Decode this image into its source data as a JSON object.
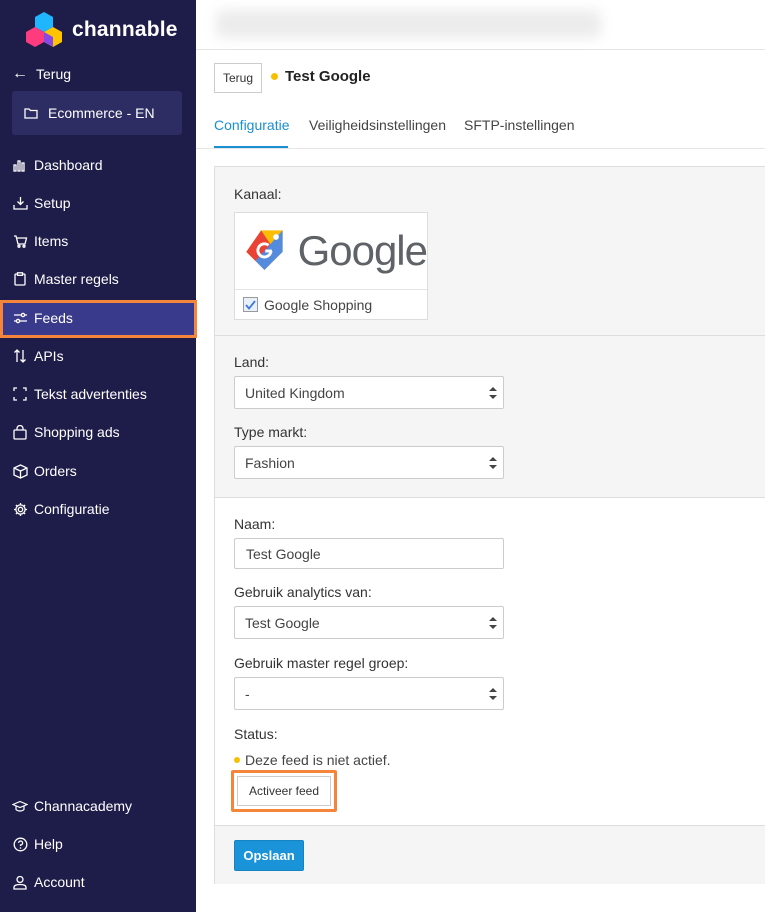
{
  "brand": {
    "name": "channable"
  },
  "sidebar": {
    "back_label": "Terug",
    "project_label": "Ecommerce - EN",
    "items": [
      {
        "label": "Dashboard",
        "icon": "chart-bars-icon"
      },
      {
        "label": "Setup",
        "icon": "download-tray-icon"
      },
      {
        "label": "Items",
        "icon": "cart-icon"
      },
      {
        "label": "Master regels",
        "icon": "clipboard-icon"
      },
      {
        "label": "Feeds",
        "icon": "sliders-icon",
        "active": true
      },
      {
        "label": "APIs",
        "icon": "arrows-up-down-icon"
      },
      {
        "label": "Tekst advertenties",
        "icon": "bracket-frame-icon"
      },
      {
        "label": "Shopping ads",
        "icon": "shopping-bag-icon"
      },
      {
        "label": "Orders",
        "icon": "box-icon"
      },
      {
        "label": "Configuratie",
        "icon": "gear-icon"
      }
    ],
    "bottom_items": [
      {
        "label": "Channacademy",
        "icon": "graduation-cap-icon"
      },
      {
        "label": "Help",
        "icon": "question-circle-icon"
      },
      {
        "label": "Account",
        "icon": "user-icon"
      }
    ],
    "active_color": "#3a3a8c",
    "highlight_color": "#f4853a"
  },
  "header": {
    "back_button": "Terug",
    "feed_title": "Test Google",
    "status_dot_color": "#f5c000"
  },
  "tabs": [
    {
      "label": "Configuratie",
      "active": true
    },
    {
      "label": "Veiligheidsinstellingen"
    },
    {
      "label": "SFTP-instellingen"
    }
  ],
  "form": {
    "channel_label": "Kanaal:",
    "channel_logo_text": "Google",
    "channel_name": "Google Shopping",
    "channel_checked": true,
    "country_label": "Land:",
    "country_value": "United Kingdom",
    "market_label": "Type markt:",
    "market_value": "Fashion",
    "name_label": "Naam:",
    "name_value": "Test Google",
    "analytics_label": "Gebruik analytics van:",
    "analytics_value": "Test Google",
    "master_group_label": "Gebruik master regel groep:",
    "master_group_value": "-",
    "status_label": "Status:",
    "status_text": "Deze feed is niet actief.",
    "activate_button": "Activeer feed",
    "save_button": "Opslaan"
  }
}
